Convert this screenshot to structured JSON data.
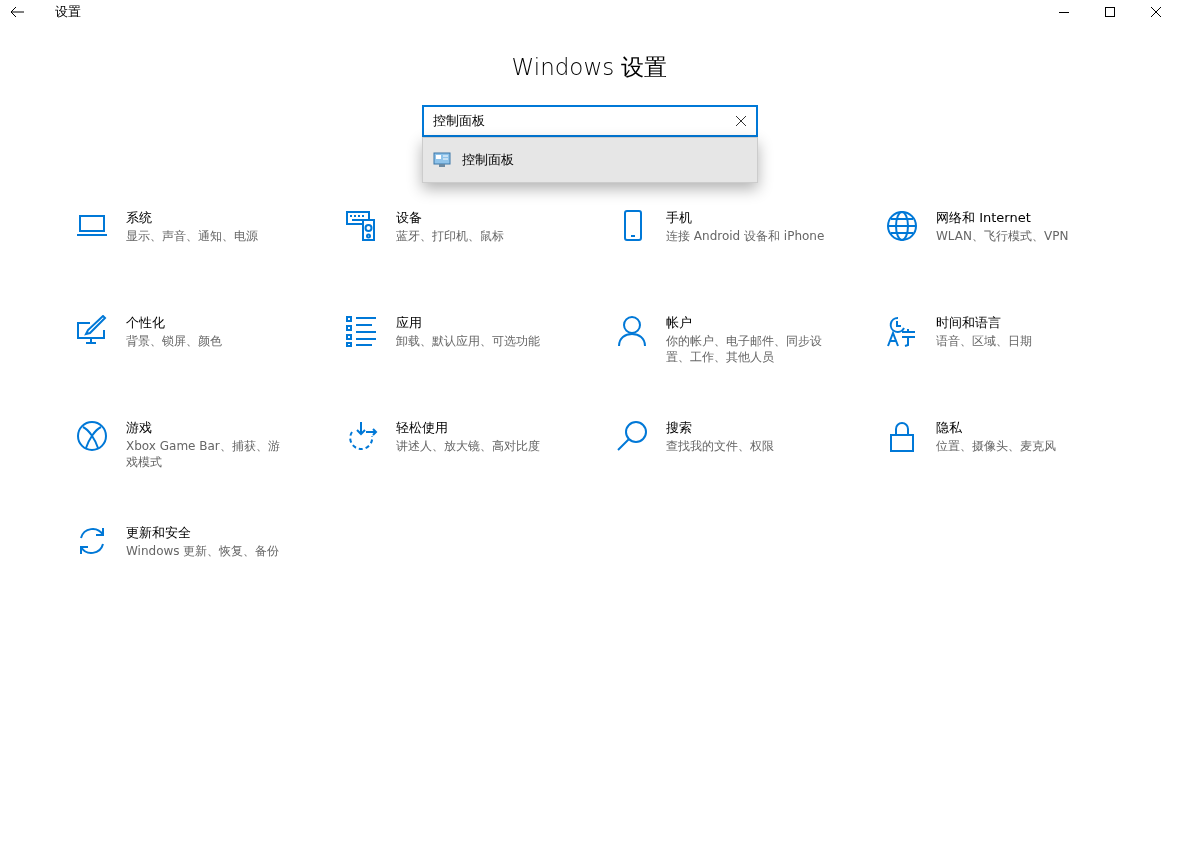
{
  "window": {
    "title": "设置"
  },
  "heading": "Windows 设置",
  "search": {
    "value": "控制面板",
    "suggestions": [
      {
        "label": "控制面板",
        "selected": true
      }
    ]
  },
  "tiles": [
    {
      "kind": "laptop",
      "title": "系统",
      "description": "显示、声音、通知、电源"
    },
    {
      "kind": "devices",
      "title": "设备",
      "description": "蓝牙、打印机、鼠标"
    },
    {
      "kind": "phone",
      "title": "手机",
      "description": "连接 Android 设备和 iPhone"
    },
    {
      "kind": "globe",
      "title": "网络和 Internet",
      "description": "WLAN、飞行模式、VPN"
    },
    {
      "kind": "brush",
      "title": "个性化",
      "description": "背景、锁屏、颜色"
    },
    {
      "kind": "list",
      "title": "应用",
      "description": "卸载、默认应用、可选功能"
    },
    {
      "kind": "person",
      "title": "帐户",
      "description": "你的帐户、电子邮件、同步设置、工作、其他人员"
    },
    {
      "kind": "timelang",
      "title": "时间和语言",
      "description": "语音、区域、日期"
    },
    {
      "kind": "xbox",
      "title": "游戏",
      "description": "Xbox Game Bar、捕获、游戏模式"
    },
    {
      "kind": "ease",
      "title": "轻松使用",
      "description": "讲述人、放大镜、高对比度"
    },
    {
      "kind": "search",
      "title": "搜索",
      "description": "查找我的文件、权限"
    },
    {
      "kind": "lock",
      "title": "隐私",
      "description": "位置、摄像头、麦克风"
    },
    {
      "kind": "sync",
      "title": "更新和安全",
      "description": "Windows 更新、恢复、备份"
    }
  ]
}
